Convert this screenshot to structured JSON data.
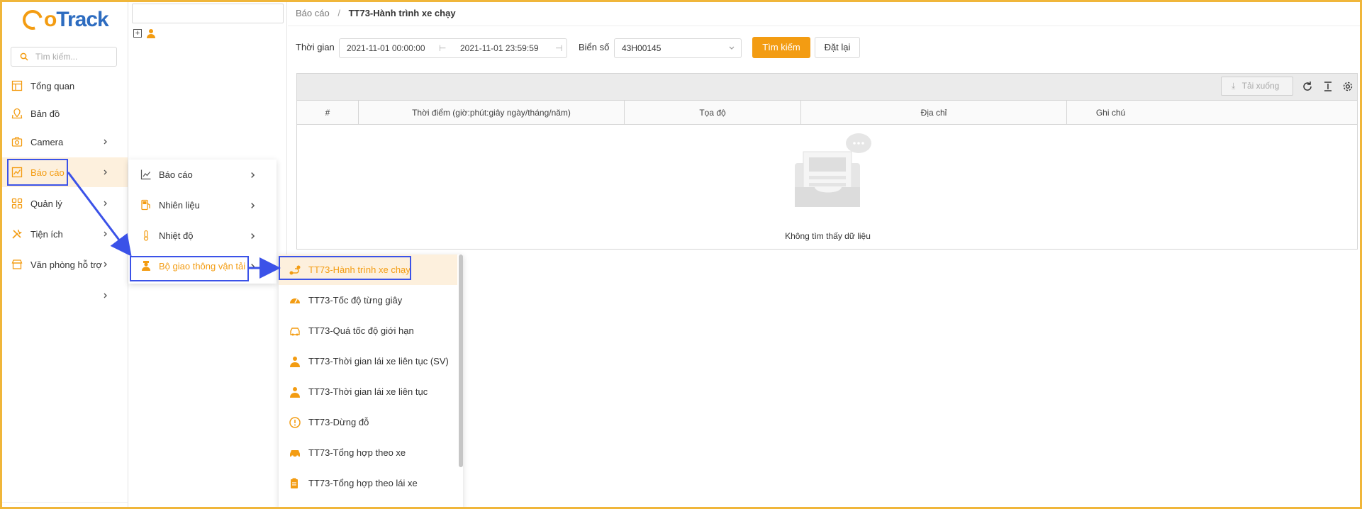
{
  "app": {
    "logo_prefix": "G",
    "logo_text_orange": "o",
    "logo_text_blue": "Track"
  },
  "sidebar": {
    "search_placeholder": "Tìm kiếm...",
    "items": [
      {
        "label": "Tổng quan",
        "icon": "dashboard-icon"
      },
      {
        "label": "Bản đồ",
        "icon": "map-icon"
      },
      {
        "label": "Camera",
        "icon": "camera-icon"
      },
      {
        "label": "Báo cáo",
        "icon": "chart-icon"
      },
      {
        "label": "Quản lý",
        "icon": "grid-icon"
      },
      {
        "label": "Tiện ích",
        "icon": "tools-icon"
      },
      {
        "label": "Văn phòng hỗ trợ",
        "icon": "store-icon"
      },
      {
        "label": "",
        "icon": ""
      }
    ]
  },
  "breadcrumb": {
    "parent": "Báo cáo",
    "separator": "/",
    "current": "TT73-Hành trình xe chạy"
  },
  "filters": {
    "time_label": "Thời gian",
    "start": "2021-11-01 00:00:00",
    "end": "2021-11-01 23:59:59",
    "plate_label": "Biển số",
    "plate_value": "43H00145",
    "search_button": "Tìm kiếm",
    "reset_button": "Đặt lại"
  },
  "grid": {
    "download_label": "Tải xuống",
    "columns": [
      "#",
      "Thời điểm (giờ:phút:giây ngày/tháng/năm)",
      "Tọa độ",
      "Địa chỉ",
      "Ghi chú"
    ],
    "empty_text": "Không tìm thấy dữ liệu"
  },
  "submenu": [
    {
      "label": "Báo cáo",
      "icon": "line-chart-icon"
    },
    {
      "label": "Nhiên liệu",
      "icon": "fuel-icon"
    },
    {
      "label": "Nhiệt độ",
      "icon": "thermometer-icon"
    },
    {
      "label": "Bộ giao thông vận tải",
      "icon": "driver-icon"
    }
  ],
  "submenu2": [
    {
      "label": "TT73-Hành trình xe chạy",
      "icon": "route-icon"
    },
    {
      "label": "TT73-Tốc độ từng giây",
      "icon": "speedometer-icon"
    },
    {
      "label": "TT73-Quá tốc độ giới hạn",
      "icon": "car-speed-icon"
    },
    {
      "label": "TT73-Thời gian lái xe liên tục (SV)",
      "icon": "driver-icon"
    },
    {
      "label": "TT73-Thời gian lái xe liên tục",
      "icon": "driver-icon"
    },
    {
      "label": "TT73-Dừng đỗ",
      "icon": "alert-icon"
    },
    {
      "label": "TT73-Tổng hợp theo xe",
      "icon": "car-icon"
    },
    {
      "label": "TT73-Tổng hợp theo lái xe",
      "icon": "clipboard-icon"
    }
  ],
  "colors": {
    "accent": "#f39c12",
    "brand_blue": "#2d6cc0",
    "highlight": "#3b52e8",
    "active_bg": "#fdf0dd"
  }
}
